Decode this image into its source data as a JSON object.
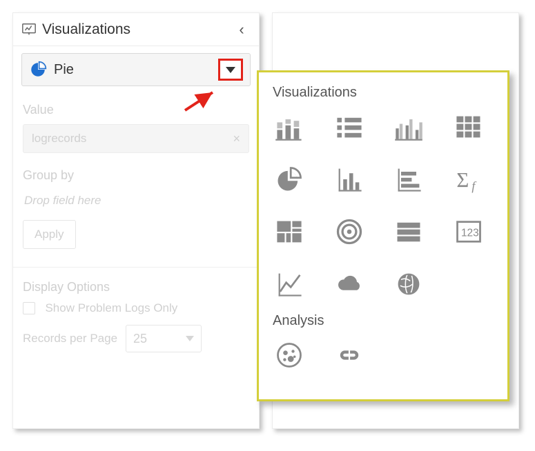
{
  "panel": {
    "title": "Visualizations",
    "selected": {
      "label": "Pie"
    },
    "value_section_label": "Value",
    "value_field": "logrecords",
    "groupby_label": "Group by",
    "groupby_placeholder": "Drop field here",
    "apply_label": "Apply",
    "display_options_heading": "Display Options",
    "show_problem_logs_label": "Show Problem Logs Only",
    "records_per_page_label": "Records per Page",
    "records_per_page_value": "25"
  },
  "popup": {
    "section_viz": "Visualizations",
    "section_analysis": "Analysis",
    "viz_items": [
      "stacked-bar",
      "list",
      "grouped-bar",
      "grid",
      "pie",
      "bar",
      "horizontal-bar",
      "summation",
      "treemap",
      "target-gauge",
      "table-rows",
      "number-tile",
      "line",
      "cloud",
      "globe"
    ],
    "analysis_items": [
      "cluster",
      "link"
    ]
  }
}
